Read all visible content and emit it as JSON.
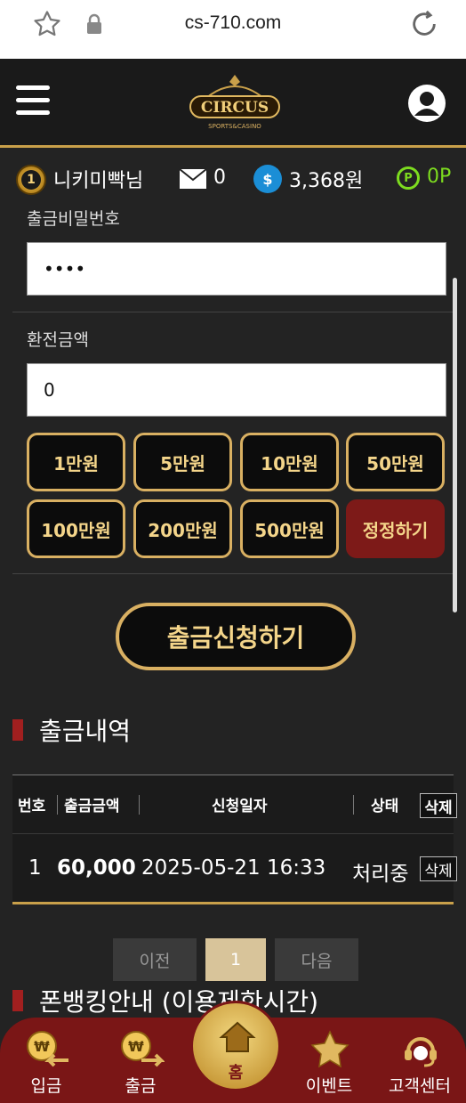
{
  "browser": {
    "url": "cs-710.com"
  },
  "header": {
    "logo_text": "CIRCUS",
    "logo_sub": "SPORTS&CASINO"
  },
  "user": {
    "level": "1",
    "nickname": "니키미빡님",
    "messages": "0",
    "money": "3,368원",
    "points": "0P"
  },
  "form": {
    "password_label": "출금비밀번호",
    "password_value": "••••",
    "amount_label": "환전금액",
    "amount_value": "0",
    "amount_buttons": [
      "1만원",
      "5만원",
      "10만원",
      "50만원",
      "100만원",
      "200만원",
      "500만원"
    ],
    "reset_label": "정정하기",
    "submit_label": "출금신청하기"
  },
  "history": {
    "title": "출금내역",
    "columns": [
      "번호",
      "출금금액",
      "신청일자",
      "상태"
    ],
    "delete_label": "삭제",
    "rows": [
      {
        "no": "1",
        "amount": "60,000",
        "date": "2025-05-21 16:33",
        "status": "처리중"
      }
    ]
  },
  "pagination": {
    "prev": "이전",
    "current": "1",
    "next": "다음"
  },
  "phone_banking": {
    "title": "폰뱅킹안내 (이용제한시간)"
  },
  "nav": {
    "deposit": "입금",
    "withdraw": "출금",
    "home": "홈",
    "event": "이벤트",
    "support": "고객센터"
  },
  "colors": {
    "gold": "#d9b062",
    "accent_red": "#7a1616",
    "point_green": "#7ddc1f"
  }
}
